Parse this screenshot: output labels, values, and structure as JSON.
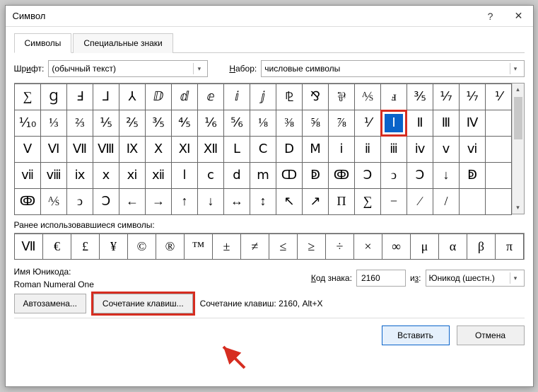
{
  "titlebar": {
    "title": "Символ"
  },
  "tabs": {
    "symbols": "Символы",
    "special": "Специальные знаки"
  },
  "font": {
    "label_pre": "Шр",
    "label_ul": "и",
    "label_post": "фт:",
    "value": "(обычный текст)"
  },
  "set": {
    "label_pre": "",
    "label_ul": "Н",
    "label_post": "абор:",
    "value": "числовые символы"
  },
  "grid": [
    [
      "∑",
      "Ɡ",
      "Ⅎ",
      "⅃",
      "⅄",
      "ⅅ",
      "ⅆ",
      "ⅇ",
      "ⅈ",
      "ⅉ",
      "⅊",
      "⅋",
      "⅌",
      "⅍",
      "ⅎ",
      "⅗",
      "⅐",
      "⅐",
      "⅟",
      "⅟"
    ],
    [
      "⅒",
      "⅓",
      "⅔",
      "⅕",
      "⅖",
      "⅗",
      "⅘",
      "⅙",
      "⅚",
      "⅛",
      "⅜",
      "⅝",
      "⅞",
      "⅟",
      "Ⅰ",
      "Ⅱ",
      "Ⅲ",
      "Ⅳ"
    ],
    [
      "Ⅴ",
      "Ⅵ",
      "Ⅶ",
      "Ⅷ",
      "Ⅸ",
      "Ⅹ",
      "Ⅺ",
      "Ⅻ",
      "Ⅼ",
      "Ⅽ",
      "Ⅾ",
      "Ⅿ",
      "ⅰ",
      "ⅱ",
      "ⅲ",
      "ⅳ",
      "ⅴ",
      "ⅵ"
    ],
    [
      "ⅶ",
      "ⅷ",
      "ⅸ",
      "ⅹ",
      "ⅺ",
      "ⅻ",
      "ⅼ",
      "ⅽ",
      "ⅾ",
      "ⅿ",
      "ↀ",
      "ↁ",
      "ↂ",
      "Ↄ",
      "ↄ",
      "Ↄ",
      "↓",
      "ↁ"
    ],
    [
      "ↂ",
      "⅍",
      "ↄ",
      "Ↄ",
      "←",
      "→",
      "↑",
      "↓",
      "↔",
      "↕",
      "↖",
      "↗",
      "Π",
      "∑",
      "−",
      "∕",
      "/"
    ]
  ],
  "grid_flat_count_row0": 19,
  "selected_index": {
    "row": 1,
    "col": 14
  },
  "recent_label": "Ранее использовавшиеся символы:",
  "recent": [
    "Ⅶ",
    "€",
    "£",
    "¥",
    "©",
    "®",
    "™",
    "±",
    "≠",
    "≤",
    "≥",
    "÷",
    "×",
    "∞",
    "μ",
    "α",
    "β",
    "π"
  ],
  "unicode_label": "Имя Юникода:",
  "unicode_name": "Roman Numeral One",
  "code": {
    "label_pre": "",
    "label_ul": "К",
    "label_post": "од знака:",
    "value": "2160"
  },
  "from": {
    "label_pre": "и",
    "label_ul": "з",
    "label_post": ":",
    "value": "Юникод (шестн.)"
  },
  "autocorrect_btn": "Автозамена...",
  "shortcut_btn": "Сочетание клавиш...",
  "shortcut_text": "Сочетание клавиш: 2160, Alt+X",
  "insert_btn": "Вставить",
  "cancel_btn": "Отмена"
}
